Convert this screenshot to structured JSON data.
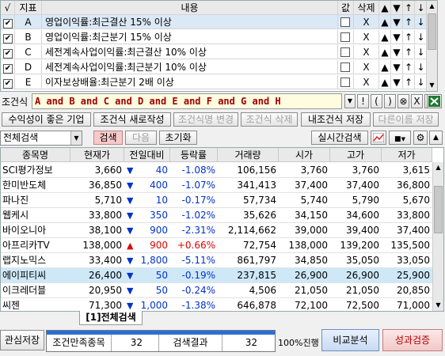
{
  "criteria": {
    "headers": [
      "√",
      "지표",
      "내용",
      "값",
      "삭제",
      "▲",
      "▼",
      "↑",
      "↓"
    ],
    "rows": [
      {
        "checked": true,
        "id": "A",
        "content": "영업이익률:최근결산 15% 이상"
      },
      {
        "checked": true,
        "id": "B",
        "content": "영업이익률:최근분기 15% 이상"
      },
      {
        "checked": true,
        "id": "C",
        "content": "세전계속사업이익률:최근결산 10% 이상"
      },
      {
        "checked": true,
        "id": "D",
        "content": "세전계속사업이익률:최근분기 10% 이상"
      },
      {
        "checked": true,
        "id": "E",
        "content": "이자보상배율:최근분기 2배 이상"
      }
    ],
    "delete_mark": "X"
  },
  "formula": {
    "label": "조건식",
    "text": "A and B and C and D and E and F and G and H",
    "tools": [
      "▼",
      "!",
      "(",
      ")",
      "⊗",
      "X",
      "?"
    ]
  },
  "condition_buttons": {
    "title_button": "수익성이 좋은 기업",
    "new": "조건식 새로작성",
    "rename": "조건식명 변경",
    "delete": "조건식 삭제",
    "save_mine": "내조건식 저장",
    "save_as": "다른이름 저장"
  },
  "search_bar": {
    "scope": "전체검색",
    "search": "검색",
    "next": "다음",
    "reset": "초기화",
    "realtime": "실시간검색"
  },
  "table": {
    "columns": [
      "종목명",
      "현재가",
      "전일대비",
      "등락률",
      "거래량",
      "시가",
      "고가",
      "저가"
    ],
    "rows": [
      {
        "name": "SCI평가정보",
        "price": "3,660",
        "dir": "down",
        "change": "40",
        "rate": "-1.08%",
        "volume": "106,156",
        "open": "3,760",
        "high": "3,760",
        "low": "3,615"
      },
      {
        "name": "한미반도체",
        "price": "36,850",
        "dir": "down",
        "change": "400",
        "rate": "-1.07%",
        "volume": "341,413",
        "open": "37,400",
        "high": "37,400",
        "low": "36,800"
      },
      {
        "name": "파나진",
        "price": "5,710",
        "dir": "down",
        "change": "10",
        "rate": "-0.17%",
        "volume": "57,734",
        "open": "5,740",
        "high": "5,790",
        "low": "5,670"
      },
      {
        "name": "웹케시",
        "price": "33,800",
        "dir": "down",
        "change": "350",
        "rate": "-1.02%",
        "volume": "35,626",
        "open": "34,150",
        "high": "34,600",
        "low": "33,800"
      },
      {
        "name": "바이오니아",
        "price": "38,100",
        "dir": "down",
        "change": "900",
        "rate": "-2.31%",
        "volume": "2,114,662",
        "open": "39,000",
        "high": "39,400",
        "low": "37,400"
      },
      {
        "name": "아프리카TV",
        "price": "138,000",
        "dir": "up",
        "change": "900",
        "rate": "+0.66%",
        "volume": "72,754",
        "open": "138,000",
        "high": "139,200",
        "low": "135,500"
      },
      {
        "name": "랩지노믹스",
        "price": "33,400",
        "dir": "down",
        "change": "1,800",
        "rate": "-5.11%",
        "volume": "861,797",
        "open": "34,850",
        "high": "35,050",
        "low": "33,050"
      },
      {
        "name": "에이피티씨",
        "price": "26,400",
        "dir": "down",
        "change": "50",
        "rate": "-0.19%",
        "volume": "237,815",
        "open": "26,900",
        "high": "26,900",
        "low": "25,900"
      },
      {
        "name": "이크레더블",
        "price": "20,950",
        "dir": "down",
        "change": "50",
        "rate": "-0.24%",
        "volume": "4,506",
        "open": "21,050",
        "high": "21,050",
        "low": "20,850"
      },
      {
        "name": "씨젠",
        "price": "71,300",
        "dir": "down",
        "change": "1,000",
        "rate": "-1.38%",
        "volume": "646,878",
        "open": "72,100",
        "high": "72,500",
        "low": "71,000"
      }
    ],
    "selected_index": 7,
    "tab": "[1]전체검색"
  },
  "footer": {
    "save_interest": "관심저장",
    "match_label": "조건만족종목",
    "match_value": "32",
    "result_label": "검색결과",
    "result_value": "32",
    "progress": "100%진행",
    "progress_fraction": 1.0,
    "compare": "비교분석",
    "verify": "성과검증"
  },
  "colors": {
    "up": "#e00000",
    "down": "#0033cc",
    "accent_blue": "#2a6fd6",
    "excel_green": "#1e7b34"
  }
}
